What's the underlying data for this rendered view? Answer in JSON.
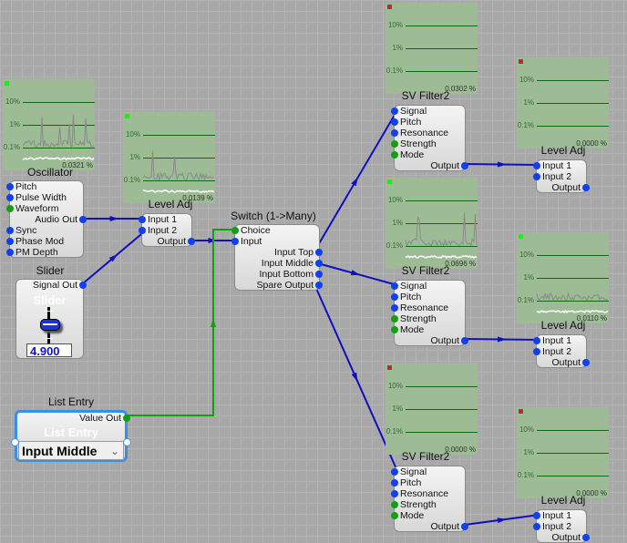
{
  "colors": {
    "signal_pin": "#1040f0",
    "control_pin": "#10a010",
    "wire_signal": "#1010c0",
    "wire_control": "#10a010",
    "scope_bg": "#9dbb95",
    "indicator_active": "#00ff00",
    "indicator_idle": "#b03030"
  },
  "scope_gridlabels": [
    "10%",
    "1%",
    "0.1%"
  ],
  "scopes": [
    {
      "readout": "0.0321 %",
      "active": true,
      "trace": true
    },
    {
      "readout": "0.0139 %",
      "active": true,
      "trace": true
    },
    {
      "readout": "0.0302 %",
      "active": false,
      "trace": false
    },
    {
      "readout": "0.0000 %",
      "active": false,
      "trace": false
    },
    {
      "readout": "0.0696 %",
      "active": true,
      "trace": true
    },
    {
      "readout": "0.0110 %",
      "active": true,
      "trace": true
    },
    {
      "readout": "0.0000 %",
      "active": false,
      "trace": false
    },
    {
      "readout": "0.0000 %",
      "active": false,
      "trace": false
    }
  ],
  "modules": [
    {
      "title": "Oscillator",
      "pins": [
        {
          "label": "Pitch",
          "side": "l",
          "type": "signal"
        },
        {
          "label": "Pulse Width",
          "side": "l",
          "type": "signal"
        },
        {
          "label": "Waveform",
          "side": "l",
          "type": "control"
        },
        {
          "label": "Audio Out",
          "side": "r",
          "type": "signal"
        },
        {
          "label": "Sync",
          "side": "l",
          "type": "signal"
        },
        {
          "label": "Phase Mod",
          "side": "l",
          "type": "signal"
        },
        {
          "label": "PM Depth",
          "side": "l",
          "type": "signal"
        }
      ]
    },
    {
      "title": "Level Adj",
      "pins": [
        {
          "label": "Input 1",
          "side": "l",
          "type": "signal"
        },
        {
          "label": "Input 2",
          "side": "l",
          "type": "signal"
        },
        {
          "label": "Output",
          "side": "r",
          "type": "signal"
        }
      ]
    },
    {
      "title": "Switch (1->Many)",
      "pins": [
        {
          "label": "Choice",
          "side": "l",
          "type": "control"
        },
        {
          "label": "Input",
          "side": "l",
          "type": "signal"
        },
        {
          "label": "Input Top",
          "side": "r",
          "type": "signal"
        },
        {
          "label": "Input Middle",
          "side": "r",
          "type": "signal"
        },
        {
          "label": "Input Bottom",
          "side": "r",
          "type": "signal"
        },
        {
          "label": "Spare Output",
          "side": "r",
          "type": "signal"
        }
      ]
    },
    {
      "title": "SV Filter2",
      "pins": [
        {
          "label": "Signal",
          "side": "l",
          "type": "signal"
        },
        {
          "label": "Pitch",
          "side": "l",
          "type": "signal"
        },
        {
          "label": "Resonance",
          "side": "l",
          "type": "signal"
        },
        {
          "label": "Strength",
          "side": "l",
          "type": "control"
        },
        {
          "label": "Mode",
          "side": "l",
          "type": "control"
        },
        {
          "label": "Output",
          "side": "r",
          "type": "signal"
        }
      ]
    },
    {
      "title": "Level Adj",
      "pins": [
        {
          "label": "Input 1",
          "side": "l",
          "type": "signal"
        },
        {
          "label": "Input 2",
          "side": "l",
          "type": "signal"
        },
        {
          "label": "Output",
          "side": "r",
          "type": "signal"
        }
      ]
    },
    {
      "title": "SV Filter2",
      "pins": [
        {
          "label": "Signal",
          "side": "l",
          "type": "signal"
        },
        {
          "label": "Pitch",
          "side": "l",
          "type": "signal"
        },
        {
          "label": "Resonance",
          "side": "l",
          "type": "signal"
        },
        {
          "label": "Strength",
          "side": "l",
          "type": "control"
        },
        {
          "label": "Mode",
          "side": "l",
          "type": "control"
        },
        {
          "label": "Output",
          "side": "r",
          "type": "signal"
        }
      ]
    },
    {
      "title": "Level Adj",
      "pins": [
        {
          "label": "Input 1",
          "side": "l",
          "type": "signal"
        },
        {
          "label": "Input 2",
          "side": "l",
          "type": "signal"
        },
        {
          "label": "Output",
          "side": "r",
          "type": "signal"
        }
      ]
    },
    {
      "title": "SV Filter2",
      "pins": [
        {
          "label": "Signal",
          "side": "l",
          "type": "signal"
        },
        {
          "label": "Pitch",
          "side": "l",
          "type": "signal"
        },
        {
          "label": "Resonance",
          "side": "l",
          "type": "signal"
        },
        {
          "label": "Strength",
          "side": "l",
          "type": "control"
        },
        {
          "label": "Mode",
          "side": "l",
          "type": "control"
        },
        {
          "label": "Output",
          "side": "r",
          "type": "signal"
        }
      ]
    },
    {
      "title": "Level Adj",
      "pins": [
        {
          "label": "Input 1",
          "side": "l",
          "type": "signal"
        },
        {
          "label": "Input 2",
          "side": "l",
          "type": "signal"
        },
        {
          "label": "Output",
          "side": "r",
          "type": "signal"
        }
      ]
    }
  ],
  "slider": {
    "title": "Slider",
    "output_pin": "Signal Out",
    "label": "Slider",
    "value": "4.900",
    "position": 0.5
  },
  "list_entry": {
    "title": "List Entry",
    "output_pin": "Value Out",
    "label": "List Entry",
    "selected": "Input Middle"
  }
}
